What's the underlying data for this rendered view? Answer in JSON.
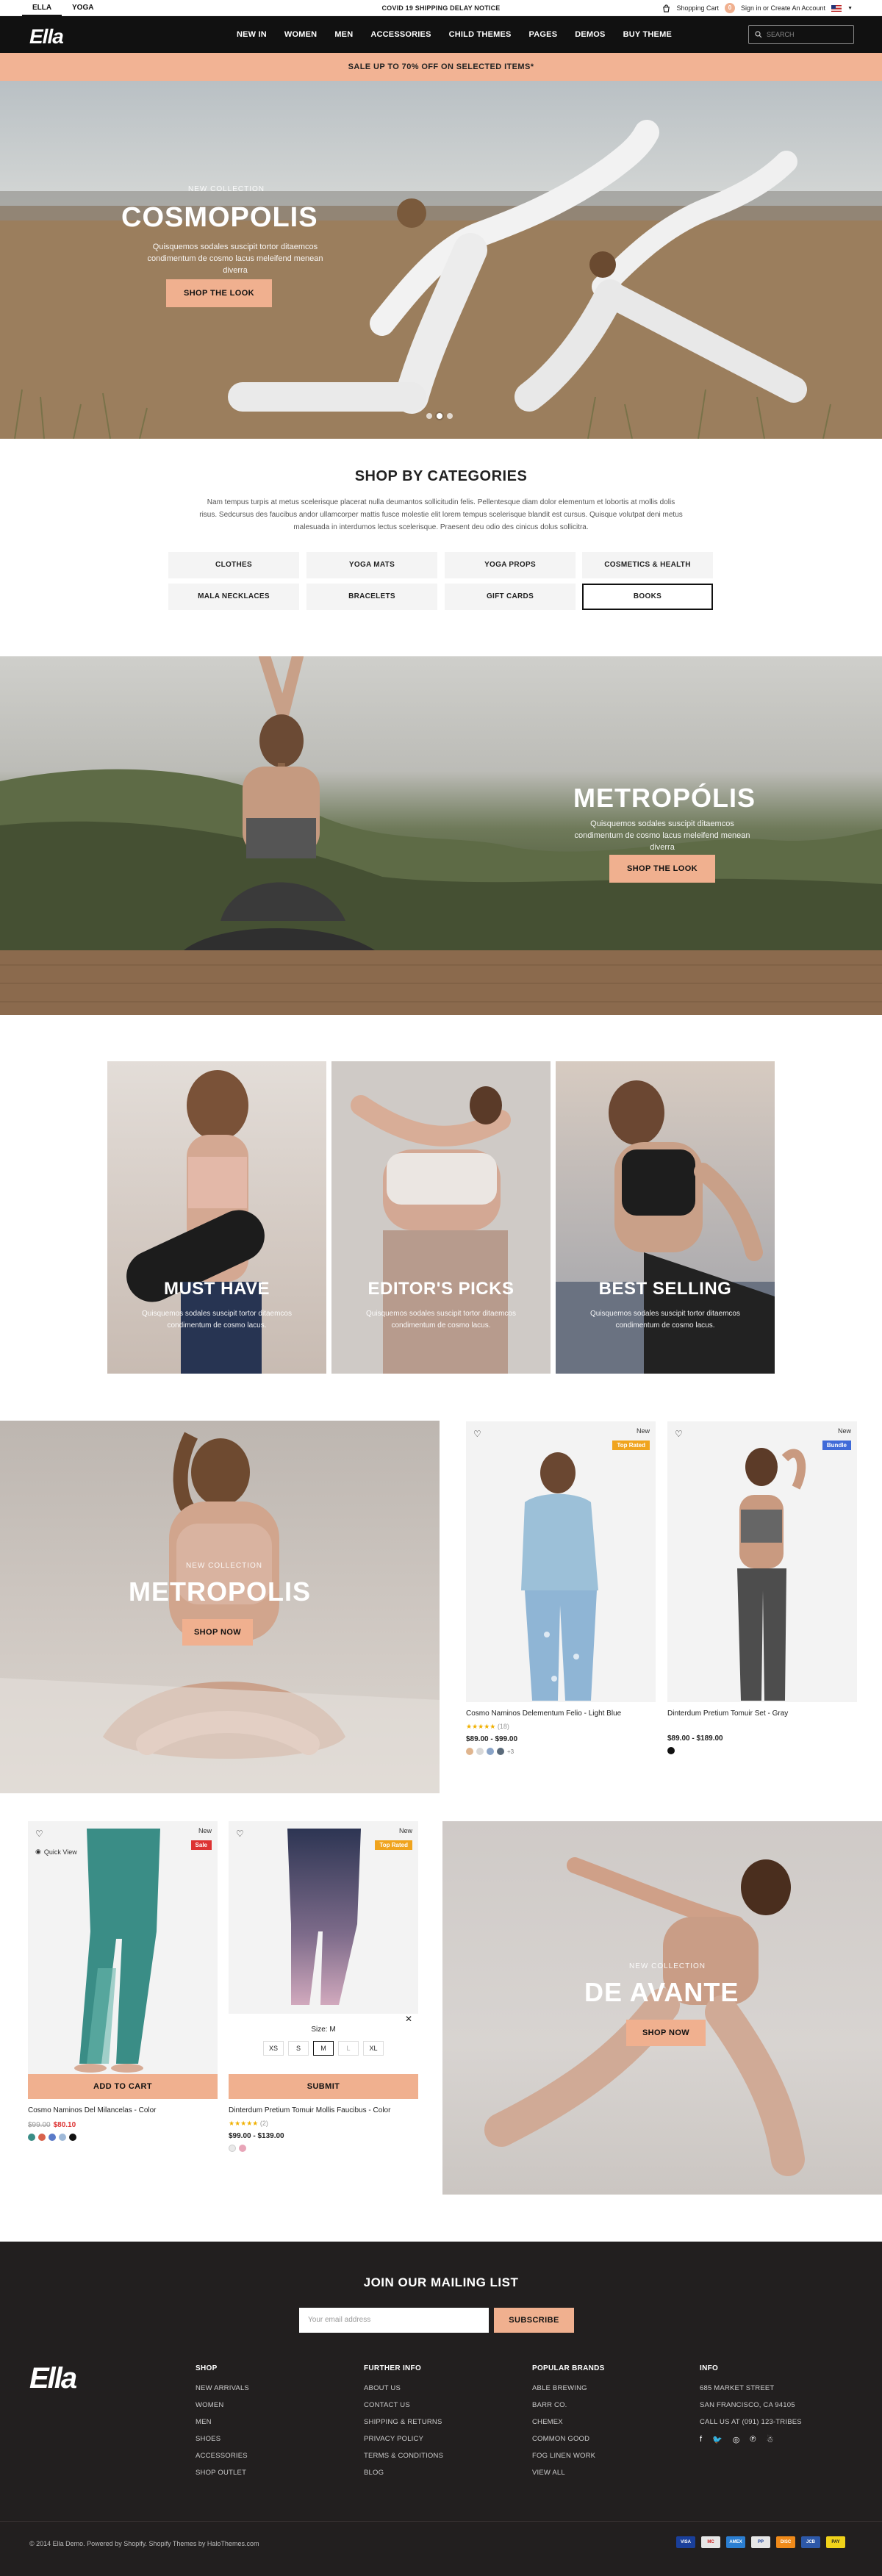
{
  "topbar": {
    "tabs": [
      "ELLA",
      "YOGA"
    ],
    "notice": "COVID 19 SHIPPING DELAY NOTICE",
    "cart_label": "Shopping Cart",
    "cart_count": "0",
    "account_label": "Sign in or Create An Account"
  },
  "nav": {
    "logo": "Ella",
    "items": [
      "NEW IN",
      "WOMEN",
      "MEN",
      "ACCESSORIES",
      "CHILD THEMES",
      "PAGES",
      "DEMOS",
      "BUY THEME"
    ],
    "search_placeholder": "SEARCH"
  },
  "promo": "SALE UP TO 70% OFF ON SELECTED ITEMS*",
  "hero": {
    "subtitle": "NEW COLLECTION",
    "title": "COSMOPOLIS",
    "desc": "Quisquemos sodales suscipit tortor ditaemcos condimentum de cosmo lacus meleifend menean diverra",
    "button": "SHOP THE LOOK"
  },
  "categories": {
    "title": "SHOP BY CATEGORIES",
    "desc": "Nam tempus turpis at metus scelerisque placerat nulla deumantos sollicitudin felis. Pellentesque diam dolor elementum et lobortis at mollis dolis risus. Sedcursus des faucibus andor ullamcorper mattis fusce molestie elit lorem tempus scelerisque blandit est cursus. Quisque volutpat deni metus malesuada in interdumos lectus scelerisque. Praesent deu odio des cinicus dolus sollicitra.",
    "items": [
      "CLOTHES",
      "YOGA MATS",
      "YOGA PROPS",
      "COSMETICS & HEALTH",
      "MALA NECKLACES",
      "BRACELETS",
      "GIFT CARDS",
      "BOOKS"
    ]
  },
  "metropolis1": {
    "title": "METROPÓLIS",
    "desc": "Quisquemos sodales suscipit ditaemcos condimentum de cosmo lacus meleifend menean diverra",
    "button": "SHOP THE LOOK"
  },
  "trio": [
    {
      "title": "MUST HAVE",
      "desc": "Quisquemos sodales suscipit tortor ditaemcos condimentum de cosmo lacus."
    },
    {
      "title": "EDITOR'S PICKS",
      "desc": "Quisquemos sodales suscipit tortor ditaemcos condimentum de cosmo lacus."
    },
    {
      "title": "BEST SELLING",
      "desc": "Quisquemos sodales suscipit tortor ditaemcos condimentum de cosmo lacus."
    }
  ],
  "metropolis2": {
    "subtitle": "NEW COLLECTION",
    "title": "METROPOLIS",
    "button": "SHOP NOW"
  },
  "products_top": [
    {
      "new": "New",
      "badge": "Top Rated",
      "name": "Cosmo Naminos Delementum Felio - Light Blue",
      "rating_count": "(18)",
      "price": "$89.00 - $99.00",
      "more": "+3"
    },
    {
      "new": "New",
      "badge": "Bundle",
      "name": "Dinterdum Pretium Tomuir Set - Gray",
      "price": "$89.00 - $189.00"
    }
  ],
  "products_bottom": [
    {
      "new": "New",
      "badge": "Sale",
      "quick": "Quick View",
      "button": "ADD TO CART",
      "name": "Cosmo Naminos Del Milancelas - Color",
      "old_price": "$99.00",
      "price": "$80.10"
    },
    {
      "new": "New",
      "badge": "Top Rated",
      "size_label": "Size:",
      "size_value": "M",
      "sizes": [
        "XS",
        "S",
        "M",
        "L",
        "XL"
      ],
      "button": "SUBMIT",
      "name": "Dinterdum Pretium Tomuir Mollis Faucibus - Color",
      "rating_count": "(2)",
      "price": "$99.00 - $139.00"
    }
  ],
  "avante": {
    "subtitle": "NEW COLLECTION",
    "title": "DE AVANTE",
    "button": "SHOP NOW"
  },
  "footer": {
    "mailing_title": "JOIN OUR MAILING LIST",
    "email_placeholder": "Your email address",
    "subscribe": "SUBSCRIBE",
    "logo": "Ella",
    "shop": {
      "title": "SHOP",
      "items": [
        "NEW ARRIVALS",
        "WOMEN",
        "MEN",
        "SHOES",
        "ACCESSORIES",
        "SHOP OUTLET"
      ]
    },
    "info": {
      "title": "FURTHER INFO",
      "items": [
        "ABOUT US",
        "CONTACT US",
        "SHIPPING & RETURNS",
        "PRIVACY POLICY",
        "TERMS & CONDITIONS",
        "BLOG"
      ]
    },
    "brands": {
      "title": "POPULAR BRANDS",
      "items": [
        "ABLE BREWING",
        "BARR CO.",
        "CHEMEX",
        "COMMON GOOD",
        "FOG LINEN WORK",
        "VIEW ALL"
      ]
    },
    "contact": {
      "title": "INFO",
      "items": [
        "685 MARKET STREET",
        "SAN FRANCISCO, CA 94105",
        "CALL US AT (091) 123-TRIBES"
      ]
    },
    "copyright": "© 2014 Ella Demo. Powered by Shopify. Shopify Themes by HaloThemes.com",
    "payments": [
      "VISA",
      "MC",
      "AMEX",
      "PP",
      "DISC",
      "JCB",
      "PAY"
    ]
  }
}
